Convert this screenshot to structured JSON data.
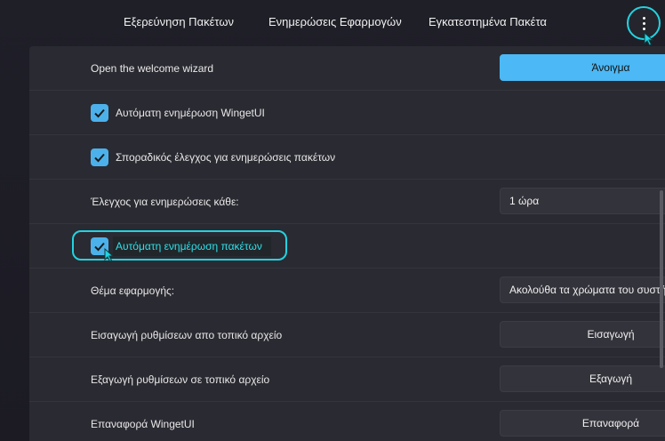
{
  "nav": {
    "tabs": [
      {
        "label": "Εξερεύνηση Πακέτων"
      },
      {
        "label": "Ενημερώσεις Εφαρμογών"
      },
      {
        "label": "Εγκατεστημένα Πακέτα"
      }
    ]
  },
  "settings": {
    "welcome": {
      "label": "Open the welcome wizard",
      "button": "Άνοιγμα"
    },
    "auto_update_wingetui": {
      "label": "Αυτόματη ενημέρωση WingetUI",
      "checked": true
    },
    "periodic_check": {
      "label": "Σποραδικός έλεγχος για ενημερώσεις πακέτων",
      "checked": true
    },
    "check_interval": {
      "label": "Έλεγχος για ενημερώσεις κάθε:",
      "value": "1 ώρα"
    },
    "auto_update_packages": {
      "label": "Αυτόματη ενημέρωση πακέτων",
      "checked": true
    },
    "theme": {
      "label": "Θέμα εφαρμογής:",
      "value": "Ακολούθα τα χρώματα του συστήματος"
    },
    "import": {
      "label": "Εισαγωγή ρυθμίσεων απο τοπικό αρχείο",
      "button": "Εισαγωγή"
    },
    "export": {
      "label": "Εξαγωγή ρυθμίσεων σε τοπικό αρχείο",
      "button": "Εξαγωγή"
    },
    "reset": {
      "label": "Επαναφορά WingetUI",
      "button": "Επαναφορά"
    }
  },
  "colors": {
    "accent": "#4cb8f5",
    "highlight": "#22d3e0",
    "panel": "#2a2a32"
  }
}
